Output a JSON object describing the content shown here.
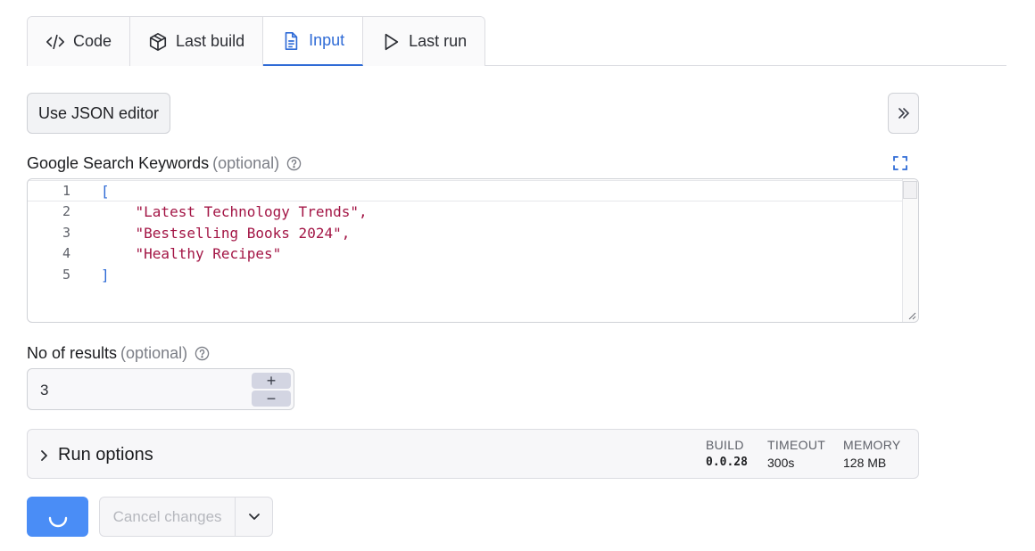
{
  "tabs": [
    {
      "label": "Code",
      "icon": "code-icon"
    },
    {
      "label": "Last build",
      "icon": "package-icon"
    },
    {
      "label": "Input",
      "icon": "document-icon",
      "active": true
    },
    {
      "label": "Last run",
      "icon": "play-icon"
    }
  ],
  "toolbar": {
    "json_editor_label": "Use JSON editor",
    "expand_icon": "double-chevron-right-icon"
  },
  "keywords_field": {
    "label": "Google Search Keywords",
    "optional": "(optional)",
    "lines": [
      {
        "num": "1",
        "text": "["
      },
      {
        "num": "2",
        "text": "    \"Latest Technology Trends\","
      },
      {
        "num": "3",
        "text": "    \"Bestselling Books 2024\","
      },
      {
        "num": "4",
        "text": "    \"Healthy Recipes\""
      },
      {
        "num": "5",
        "text": "]"
      }
    ]
  },
  "results_field": {
    "label": "No of results",
    "optional": "(optional)",
    "value": "3",
    "plus": "+",
    "minus": "−"
  },
  "run_options": {
    "title": "Run options",
    "build_key": "BUILD",
    "build_value": "0.0.28",
    "timeout_key": "TIMEOUT",
    "timeout_value": "300s",
    "memory_key": "MEMORY",
    "memory_value": "128 MB"
  },
  "actions": {
    "cancel_label": "Cancel changes"
  },
  "colors": {
    "accent": "#2f6bd6",
    "primary_button": "#4a8df6",
    "string": "#a31545"
  }
}
